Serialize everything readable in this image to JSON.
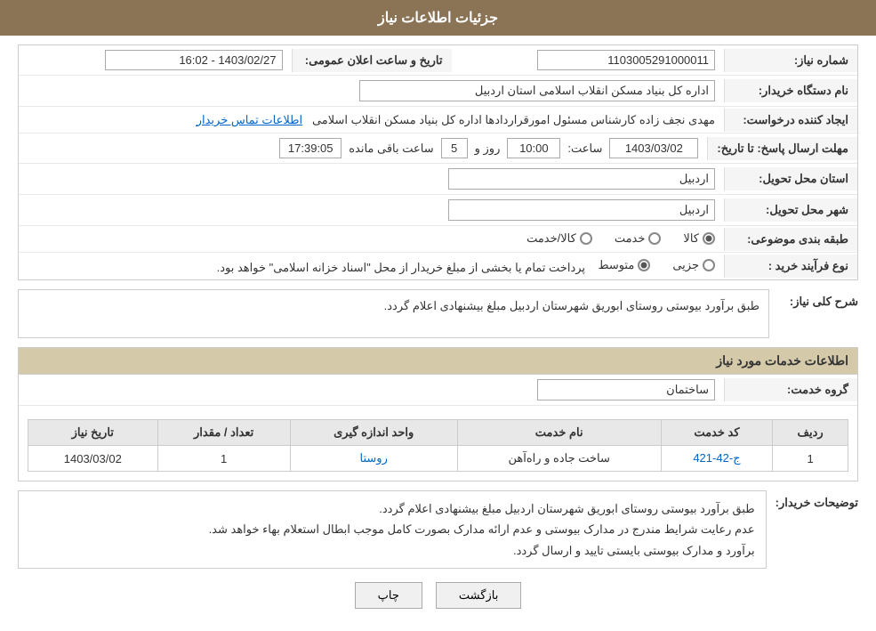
{
  "page": {
    "title": "جزئیات اطلاعات نیاز",
    "sections": {
      "need_info": {
        "fields": {
          "need_number_label": "شماره نیاز:",
          "need_number_value": "1103005291000011",
          "buyer_org_label": "نام دستگاه خریدار:",
          "buyer_org_value": "اداره کل بنیاد مسکن انقلاب اسلامی استان اردبیل",
          "requester_label": "ایجاد کننده درخواست:",
          "requester_value": "مهدی نجف زاده کارشناس مسئول امورقراردادها اداره کل بنیاد مسکن انقلاب اسلامی",
          "requester_link": "اطلاعات تماس خریدار",
          "deadline_label": "مهلت ارسال پاسخ: تا تاریخ:",
          "deadline_date": "1403/03/02",
          "deadline_time_label": "ساعت:",
          "deadline_time": "10:00",
          "deadline_day_label": "روز و",
          "deadline_day": "5",
          "deadline_remaining_label": "ساعت باقی مانده",
          "deadline_remaining": "17:39:05",
          "province_label": "استان محل تحویل:",
          "province_value": "اردبیل",
          "city_label": "شهر محل تحویل:",
          "city_value": "اردبیل",
          "category_label": "طبقه بندی موضوعی:",
          "category_kala": "کالا",
          "category_khedmat": "خدمت",
          "category_kala_khedmat": "کالا/خدمت",
          "process_label": "نوع فرآیند خرید :",
          "process_jozi": "جزیی",
          "process_motavasset": "متوسط",
          "process_desc": "پرداخت تمام یا بخشی از مبلغ خریدار از محل \"اسناد خزانه اسلامی\" خواهد بود.",
          "need_desc_label": "شرح کلی نیاز:",
          "need_desc_value": "طبق برآورد بیوستی روستای ابوریق شهرستان اردبیل مبلغ بیشنهادی اعلام گردد."
        }
      },
      "services_info": {
        "title": "اطلاعات خدمات مورد نیاز",
        "group_label": "گروه خدمت:",
        "group_value": "ساختمان",
        "table": {
          "headers": [
            "ردیف",
            "کد خدمت",
            "نام خدمت",
            "واحد اندازه گیری",
            "تعداد / مقدار",
            "تاریخ نیاز"
          ],
          "rows": [
            {
              "row_num": "1",
              "code": "ج-42-421",
              "name": "ساخت جاده و راه‌آهن",
              "unit": "روستا",
              "quantity": "1",
              "date": "1403/03/02"
            }
          ]
        }
      },
      "buyer_notes": {
        "label": "توضیحات خریدار:",
        "lines": [
          "طبق برآورد بیوستی روستای ابوریق شهرستان اردبیل مبلغ بیشنهادی اعلام گردد.",
          "عدم رعایت شرایط مندرج در مدارک بیوستی و عدم ارائه مدارک بصورت کامل موجب ابطال استعلام بهاء خواهد شد.",
          "برآورد و مدارک بیوستی بایستی تایید و ارسال گردد."
        ]
      }
    },
    "buttons": {
      "print": "چاپ",
      "back": "بازگشت"
    }
  }
}
